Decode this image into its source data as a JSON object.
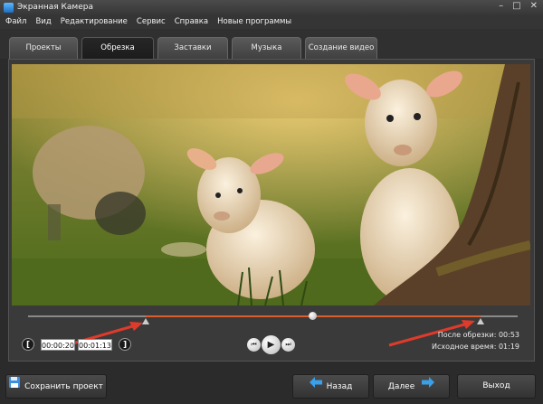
{
  "window": {
    "title": "Экранная Камера",
    "minimize": "–",
    "restore": "□",
    "close": "✕"
  },
  "menu": [
    "Файл",
    "Вид",
    "Редактирование",
    "Сервис",
    "Справка",
    "Новые программы"
  ],
  "tabs": [
    {
      "label": "Проекты",
      "active": false
    },
    {
      "label": "Обрезка",
      "active": true
    },
    {
      "label": "Заставки",
      "active": false
    },
    {
      "label": "Музыка",
      "active": false
    },
    {
      "label": "Создание видео",
      "active": false
    }
  ],
  "trim": {
    "start_time": "00:00:20",
    "end_time": "00:01:13",
    "after_trim_label": "После обрезки:",
    "after_trim_value": "00:53",
    "original_label": "Исходное время:",
    "original_value": "01:19",
    "playhead_progress": 0.58,
    "accent_color": "#d9602e"
  },
  "player": {
    "rewind": "⏮",
    "play": "▶",
    "forward": "⏭"
  },
  "footer": {
    "save_label": "Сохранить проект",
    "back_label": "Назад",
    "next_label": "Далее",
    "exit_label": "Выход"
  }
}
